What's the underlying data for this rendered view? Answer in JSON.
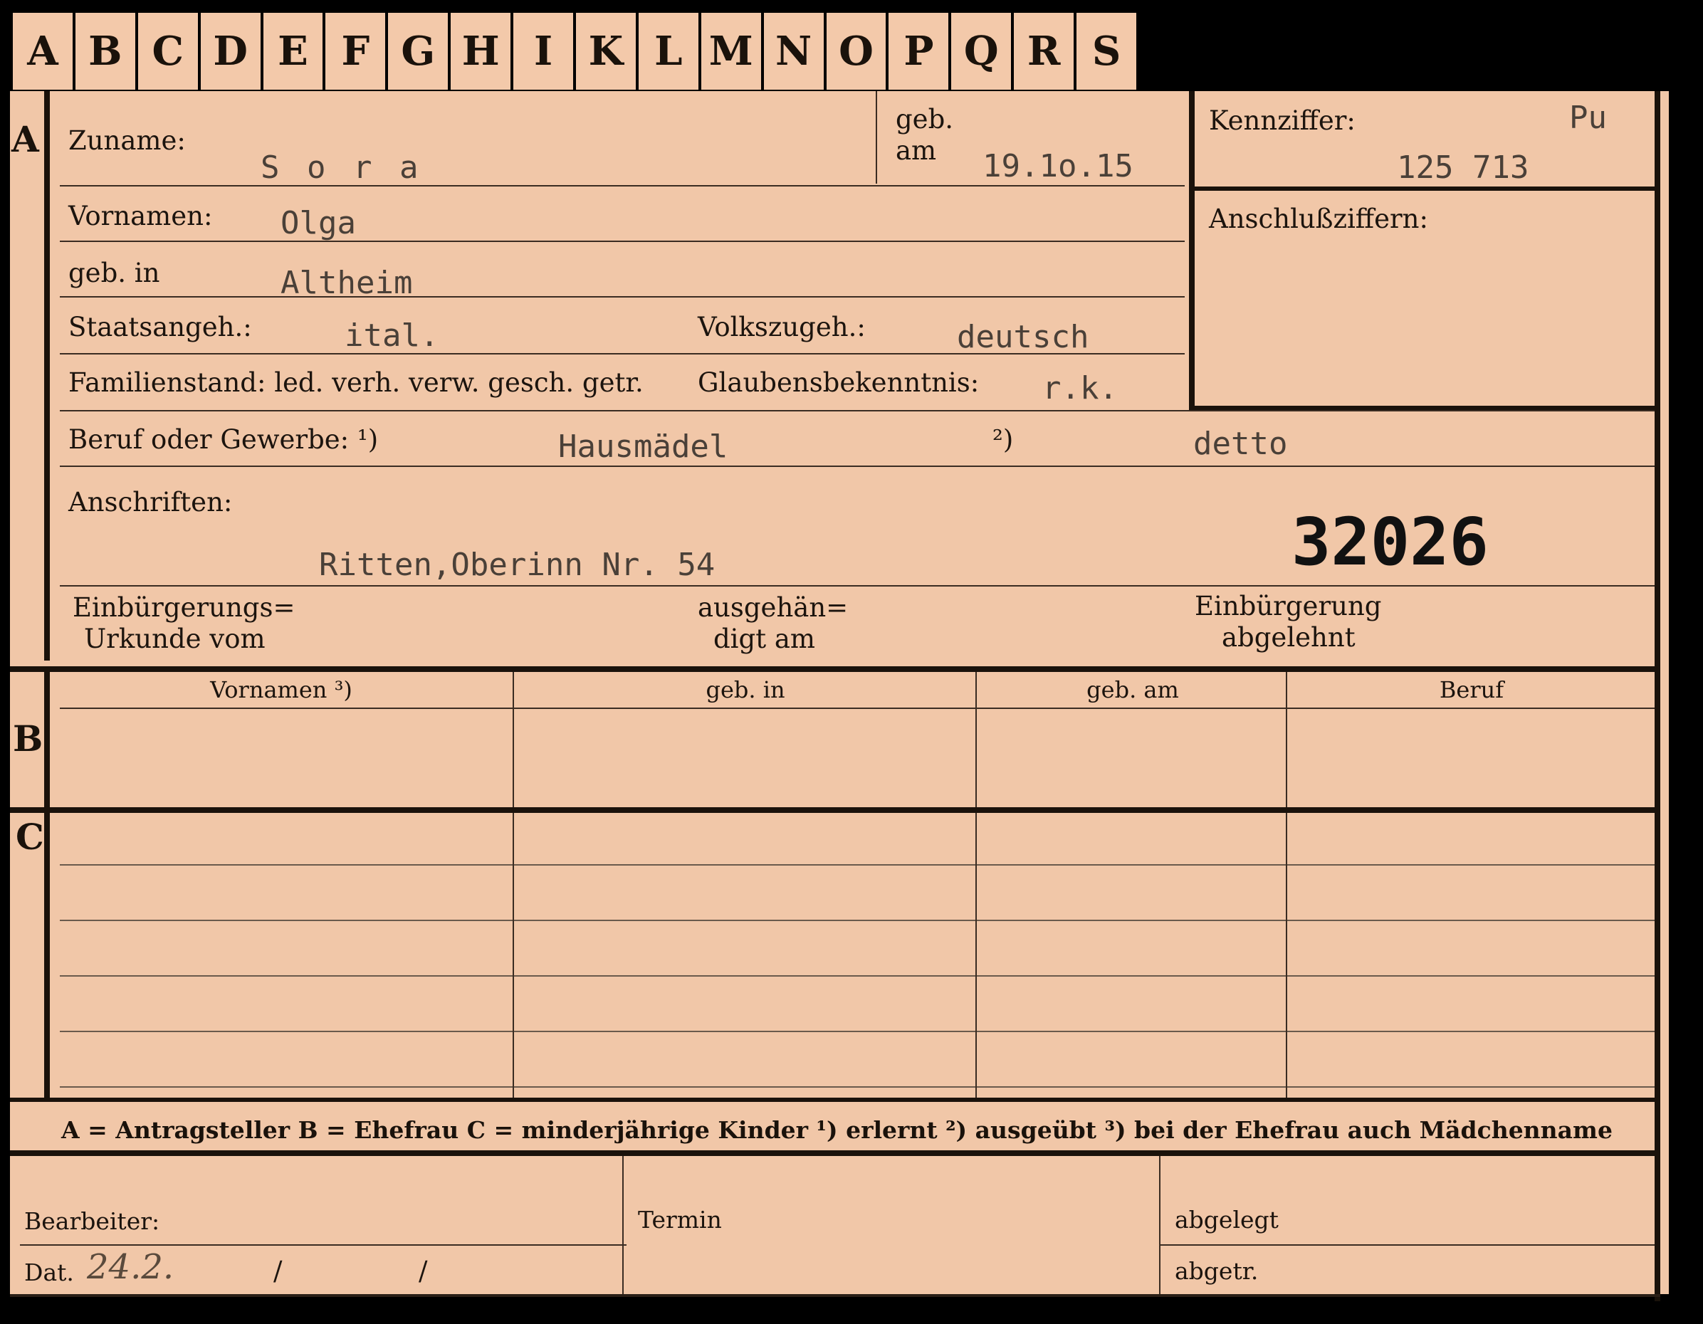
{
  "tabs": [
    "A",
    "B",
    "C",
    "D",
    "E",
    "F",
    "G",
    "H",
    "I",
    "K",
    "L",
    "M",
    "N",
    "O",
    "P",
    "Q",
    "R",
    "S"
  ],
  "section_a": {
    "marker": "A",
    "zuname_label": "Zuname:",
    "zuname_value": "S o r a",
    "geb_am_label_1": "geb.",
    "geb_am_label_2": "am",
    "geb_am_value": "19.1o.15",
    "vornamen_label": "Vornamen:",
    "vornamen_value": "Olga",
    "geb_in_label": "geb. in",
    "geb_in_value": "Altheim",
    "staatsangeh_label": "Staatsangeh.:",
    "staatsangeh_value": "ital.",
    "volkszugeh_label": "Volkszugeh.:",
    "volkszugeh_value": "deutsch",
    "familienstand_label": "Familienstand: led. verh. verw. gesch. getr.",
    "glaubens_label": "Glaubensbekenntnis:",
    "glaubens_value": "r.k.",
    "kennziffer_label": "Kennziffer:",
    "kennziffer_prefix": "Pu",
    "kennziffer_value": "125 713",
    "anschluss_label": "Anschlußziffern:",
    "beruf_label": "Beruf oder Gewerbe: ¹)",
    "beruf_value_1": "Hausmädel",
    "beruf_note_2": "²)",
    "beruf_value_2": "detto",
    "anschriften_label": "Anschriften:",
    "anschrift_value": "Ritten,Oberinn Nr. 54",
    "stamp_number": "32026",
    "einb_urkunde_label_1": "Einbürgerungs=",
    "einb_urkunde_label_2": "Urkunde vom",
    "ausgehaendigt_label_1": "ausgehän=",
    "ausgehaendigt_label_2": "digt am",
    "einb_abgelehnt_label_1": "Einbürgerung",
    "einb_abgelehnt_label_2": "abgelehnt"
  },
  "section_b": {
    "marker": "B",
    "columns": [
      "Vornamen ³)",
      "geb. in",
      "geb. am",
      "Beruf"
    ]
  },
  "section_c": {
    "marker": "C"
  },
  "legend": "A = Antragsteller   B = Ehefrau   C = minderjährige Kinder   ¹) erlernt   ²) ausgeübt   ³) bei der Ehefrau auch Mädchenname",
  "footer": {
    "bearbeiter_label": "Bearbeiter:",
    "dat_label": "Dat.",
    "dat_value": "24.2.",
    "dat_sep1": "/",
    "dat_sep2": "/",
    "termin_label": "Termin",
    "abgelegt_label": "abgelegt",
    "abgetr_label": "abgetr."
  }
}
